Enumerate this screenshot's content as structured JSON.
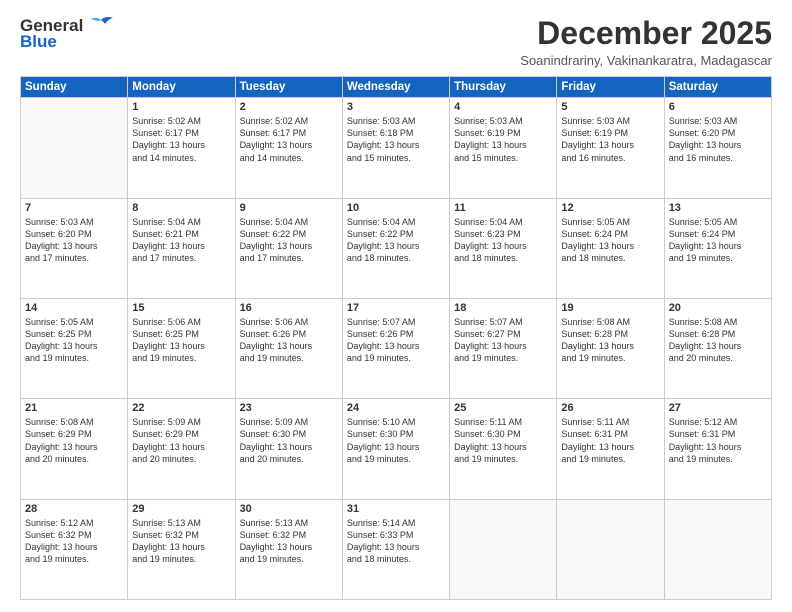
{
  "logo": {
    "line1": "General",
    "line2": "Blue"
  },
  "title": "December 2025",
  "subtitle": "Soanindrariny, Vakinankaratra, Madagascar",
  "days_header": [
    "Sunday",
    "Monday",
    "Tuesday",
    "Wednesday",
    "Thursday",
    "Friday",
    "Saturday"
  ],
  "weeks": [
    [
      {
        "num": "",
        "info": ""
      },
      {
        "num": "1",
        "info": "Sunrise: 5:02 AM\nSunset: 6:17 PM\nDaylight: 13 hours\nand 14 minutes."
      },
      {
        "num": "2",
        "info": "Sunrise: 5:02 AM\nSunset: 6:17 PM\nDaylight: 13 hours\nand 14 minutes."
      },
      {
        "num": "3",
        "info": "Sunrise: 5:03 AM\nSunset: 6:18 PM\nDaylight: 13 hours\nand 15 minutes."
      },
      {
        "num": "4",
        "info": "Sunrise: 5:03 AM\nSunset: 6:19 PM\nDaylight: 13 hours\nand 15 minutes."
      },
      {
        "num": "5",
        "info": "Sunrise: 5:03 AM\nSunset: 6:19 PM\nDaylight: 13 hours\nand 16 minutes."
      },
      {
        "num": "6",
        "info": "Sunrise: 5:03 AM\nSunset: 6:20 PM\nDaylight: 13 hours\nand 16 minutes."
      }
    ],
    [
      {
        "num": "7",
        "info": "Sunrise: 5:03 AM\nSunset: 6:20 PM\nDaylight: 13 hours\nand 17 minutes."
      },
      {
        "num": "8",
        "info": "Sunrise: 5:04 AM\nSunset: 6:21 PM\nDaylight: 13 hours\nand 17 minutes."
      },
      {
        "num": "9",
        "info": "Sunrise: 5:04 AM\nSunset: 6:22 PM\nDaylight: 13 hours\nand 17 minutes."
      },
      {
        "num": "10",
        "info": "Sunrise: 5:04 AM\nSunset: 6:22 PM\nDaylight: 13 hours\nand 18 minutes."
      },
      {
        "num": "11",
        "info": "Sunrise: 5:04 AM\nSunset: 6:23 PM\nDaylight: 13 hours\nand 18 minutes."
      },
      {
        "num": "12",
        "info": "Sunrise: 5:05 AM\nSunset: 6:24 PM\nDaylight: 13 hours\nand 18 minutes."
      },
      {
        "num": "13",
        "info": "Sunrise: 5:05 AM\nSunset: 6:24 PM\nDaylight: 13 hours\nand 19 minutes."
      }
    ],
    [
      {
        "num": "14",
        "info": "Sunrise: 5:05 AM\nSunset: 6:25 PM\nDaylight: 13 hours\nand 19 minutes."
      },
      {
        "num": "15",
        "info": "Sunrise: 5:06 AM\nSunset: 6:25 PM\nDaylight: 13 hours\nand 19 minutes."
      },
      {
        "num": "16",
        "info": "Sunrise: 5:06 AM\nSunset: 6:26 PM\nDaylight: 13 hours\nand 19 minutes."
      },
      {
        "num": "17",
        "info": "Sunrise: 5:07 AM\nSunset: 6:26 PM\nDaylight: 13 hours\nand 19 minutes."
      },
      {
        "num": "18",
        "info": "Sunrise: 5:07 AM\nSunset: 6:27 PM\nDaylight: 13 hours\nand 19 minutes."
      },
      {
        "num": "19",
        "info": "Sunrise: 5:08 AM\nSunset: 6:28 PM\nDaylight: 13 hours\nand 19 minutes."
      },
      {
        "num": "20",
        "info": "Sunrise: 5:08 AM\nSunset: 6:28 PM\nDaylight: 13 hours\nand 20 minutes."
      }
    ],
    [
      {
        "num": "21",
        "info": "Sunrise: 5:08 AM\nSunset: 6:29 PM\nDaylight: 13 hours\nand 20 minutes."
      },
      {
        "num": "22",
        "info": "Sunrise: 5:09 AM\nSunset: 6:29 PM\nDaylight: 13 hours\nand 20 minutes."
      },
      {
        "num": "23",
        "info": "Sunrise: 5:09 AM\nSunset: 6:30 PM\nDaylight: 13 hours\nand 20 minutes."
      },
      {
        "num": "24",
        "info": "Sunrise: 5:10 AM\nSunset: 6:30 PM\nDaylight: 13 hours\nand 19 minutes."
      },
      {
        "num": "25",
        "info": "Sunrise: 5:11 AM\nSunset: 6:30 PM\nDaylight: 13 hours\nand 19 minutes."
      },
      {
        "num": "26",
        "info": "Sunrise: 5:11 AM\nSunset: 6:31 PM\nDaylight: 13 hours\nand 19 minutes."
      },
      {
        "num": "27",
        "info": "Sunrise: 5:12 AM\nSunset: 6:31 PM\nDaylight: 13 hours\nand 19 minutes."
      }
    ],
    [
      {
        "num": "28",
        "info": "Sunrise: 5:12 AM\nSunset: 6:32 PM\nDaylight: 13 hours\nand 19 minutes."
      },
      {
        "num": "29",
        "info": "Sunrise: 5:13 AM\nSunset: 6:32 PM\nDaylight: 13 hours\nand 19 minutes."
      },
      {
        "num": "30",
        "info": "Sunrise: 5:13 AM\nSunset: 6:32 PM\nDaylight: 13 hours\nand 19 minutes."
      },
      {
        "num": "31",
        "info": "Sunrise: 5:14 AM\nSunset: 6:33 PM\nDaylight: 13 hours\nand 18 minutes."
      },
      {
        "num": "",
        "info": ""
      },
      {
        "num": "",
        "info": ""
      },
      {
        "num": "",
        "info": ""
      }
    ]
  ]
}
